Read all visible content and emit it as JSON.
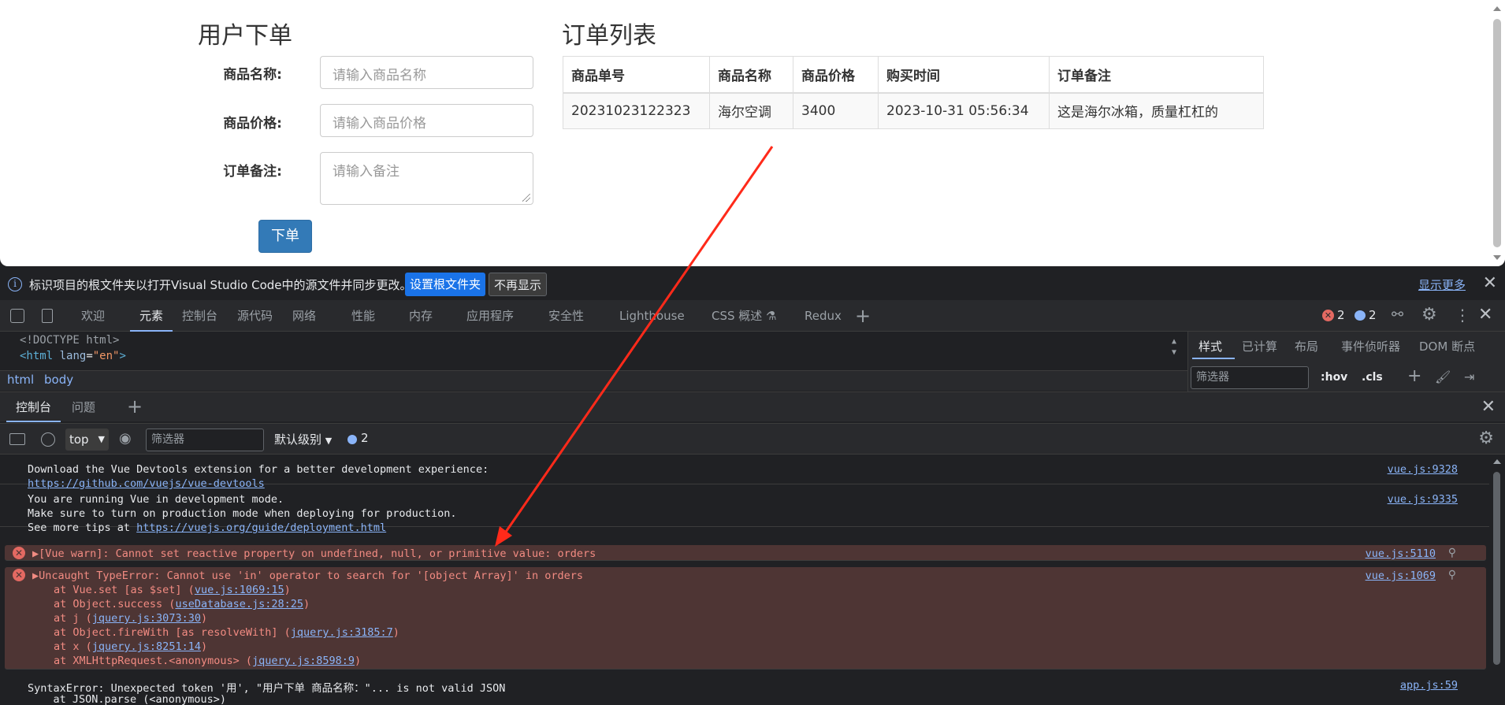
{
  "page": {
    "left_title": "用户下单",
    "right_title": "订单列表",
    "form": {
      "name_label": "商品名称:",
      "name_placeholder": "请输入商品名称",
      "price_label": "商品价格:",
      "price_placeholder": "请输入商品价格",
      "note_label": "订单备注:",
      "note_placeholder": "请输入备注",
      "submit_label": "下单"
    },
    "table": {
      "headers": [
        "商品单号",
        "商品名称",
        "商品价格",
        "购买时间",
        "订单备注"
      ],
      "rows": [
        [
          "20231023122323",
          "海尔空调",
          "3400",
          "2023-10-31 05:56:34",
          "这是海尔冰箱，质量杠杠的"
        ]
      ]
    }
  },
  "devtools": {
    "info_bar": {
      "icon": "info-icon",
      "text": "标识项目的根文件夹以打开Visual Studio Code中的源文件并同步更改。",
      "set_root_button": "设置根文件夹",
      "dismiss_button": "不再显示",
      "show_more": "显示更多"
    },
    "tabs": [
      "欢迎",
      "元素",
      "控制台",
      "源代码",
      "网络",
      "性能",
      "内存",
      "应用程序",
      "安全性",
      "Lighthouse",
      "CSS 概述 ⚗",
      "Redux"
    ],
    "active_tab": "元素",
    "error_count": "2",
    "message_count": "2",
    "dom_lines": {
      "doctype": "<!DOCTYPE html>",
      "html_open": "<html",
      "html_attr": "lang",
      "html_val": "\"en\"",
      "html_close": ">"
    },
    "breadcrumb": [
      "html",
      "body"
    ],
    "styles_tabs": [
      "样式",
      "已计算",
      "布局",
      "事件侦听器",
      "DOM 断点"
    ],
    "styles_filter_placeholder": "筛选器",
    "hov": ":hov",
    "cls": ".cls",
    "drawer_tabs": [
      "控制台",
      "问题"
    ],
    "console_toolbar": {
      "context": "top",
      "filter_placeholder": "筛选器",
      "level": "默认级别",
      "count": "2"
    },
    "console_messages": [
      {
        "lines": [
          "Download the Vue Devtools extension for a better development experience:"
        ],
        "link": "https://github.com/vuejs/vue-devtools",
        "source": "vue.js:9328"
      },
      {
        "lines": [
          "You are running Vue in development mode.",
          "Make sure to turn on production mode when deploying for production."
        ],
        "prefix": "See more tips at ",
        "link": "https://vuejs.org/guide/deployment.html",
        "source": "vue.js:9335"
      },
      {
        "text": "▶[Vue warn]: Cannot set reactive property on undefined, null, or primitive value: orders",
        "source": "vue.js:5110"
      },
      {
        "text": "▶Uncaught TypeError: Cannot use 'in' operator to search for '[object Array]' in orders",
        "source": "vue.js:1069",
        "stack": [
          {
            "pre": "at Vue.set [as $set] (",
            "link": "vue.js:1069:15",
            "post": ")"
          },
          {
            "pre": "at Object.success (",
            "link": "useDatabase.js:28:25",
            "post": ")"
          },
          {
            "pre": "at j (",
            "link": "jquery.js:3073:30",
            "post": ")"
          },
          {
            "pre": "at Object.fireWith [as resolveWith] (",
            "link": "jquery.js:3185:7",
            "post": ")"
          },
          {
            "pre": "at x (",
            "link": "jquery.js:8251:14",
            "post": ")"
          },
          {
            "pre": "at XMLHttpRequest.<anonymous> (",
            "link": "jquery.js:8598:9",
            "post": ")"
          }
        ]
      },
      {
        "lines": [
          "SyntaxError: Unexpected token '用', \"用户下单 商品名称：\"... is not valid JSON",
          "    at JSON.parse (<anonymous>)"
        ],
        "source": "app.js:59"
      }
    ]
  },
  "colors": {
    "annotation_arrow": "#ff2a1a",
    "error_bg": "#4e3534",
    "link": "#8ab4f8",
    "primary_button": "#337ab7"
  }
}
